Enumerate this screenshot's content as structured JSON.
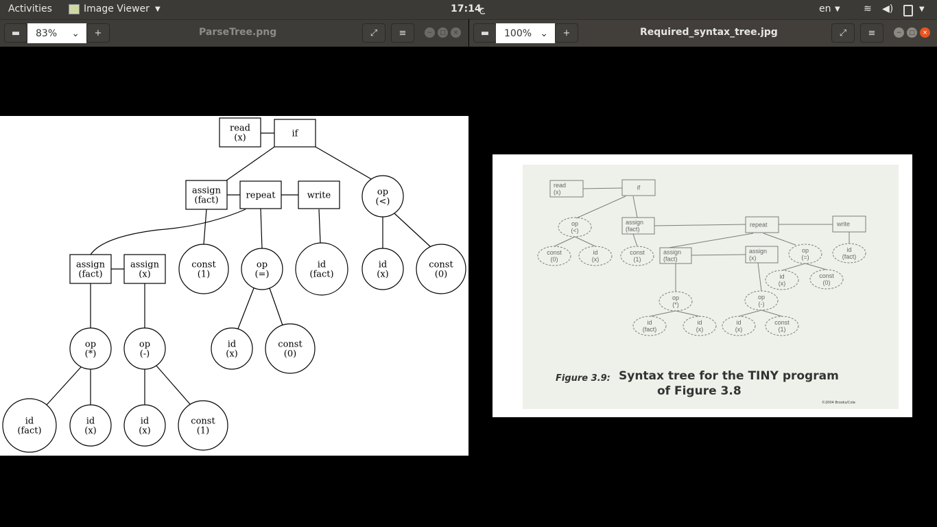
{
  "topbar": {
    "activities": "Activities",
    "app_menu": "Image Viewer",
    "clock": "17:14",
    "input_indicator": "ج",
    "language": "en"
  },
  "left_window": {
    "zoom_value": "83%",
    "title": "ParseTree.png"
  },
  "right_window": {
    "zoom_value": "100%",
    "title": "Required_syntax_tree.jpg"
  },
  "left_tree": {
    "nodes": {
      "read": "read\n(x)",
      "if": "if",
      "assign_fact": "assign\n(fact)",
      "repeat": "repeat",
      "write": "write",
      "op_lt": "op\n(<)",
      "assign_fact2": "assign\n(fact)",
      "assign_x": "assign\n(x)",
      "const_1a": "const\n(1)",
      "op_eq": "op\n(=)",
      "id_fact_w": "id\n(fact)",
      "id_x_lt": "id\n(x)",
      "const_0_lt": "const\n(0)",
      "op_mul": "op\n(*)",
      "op_minus": "op\n(-)",
      "id_x_eq": "id\n(x)",
      "const_0_eq": "const\n(0)",
      "id_fact_m": "id\n(fact)",
      "id_x_m": "id\n(x)",
      "id_x_s": "id\n(x)",
      "const_1_s": "const\n(1)"
    }
  },
  "right_tree": {
    "nodes": {
      "read": "read\n(x)",
      "if": "if",
      "op_lt": "op\n(<)",
      "assign_fact": "assign\n(fact)",
      "repeat": "repeat",
      "write": "write",
      "const_0": "const\n(0)",
      "id_x": "id\n(x)",
      "const_1": "const\n(1)",
      "assign_fact2": "assign\n(fact)",
      "assign_x": "assign\n(x)",
      "op_eq": "op\n(=)",
      "id_fact_w": "id\n(fact)",
      "id_x_eq": "id\n(x)",
      "const_0_eq": "const\n(0)",
      "op_mul": "op\n(*)",
      "op_minus": "op\n(-)",
      "id_fact_m": "id\n(fact)",
      "id_x_m": "id\n(x)",
      "id_x_s": "id\n(x)",
      "const_1_s": "const\n(1)"
    },
    "caption_label": "Figure 3.9:",
    "caption_line1": "Syntax tree for the TINY program",
    "caption_line2": "of Figure 3.8",
    "copyright": "©2004 Brooks/Cole"
  }
}
